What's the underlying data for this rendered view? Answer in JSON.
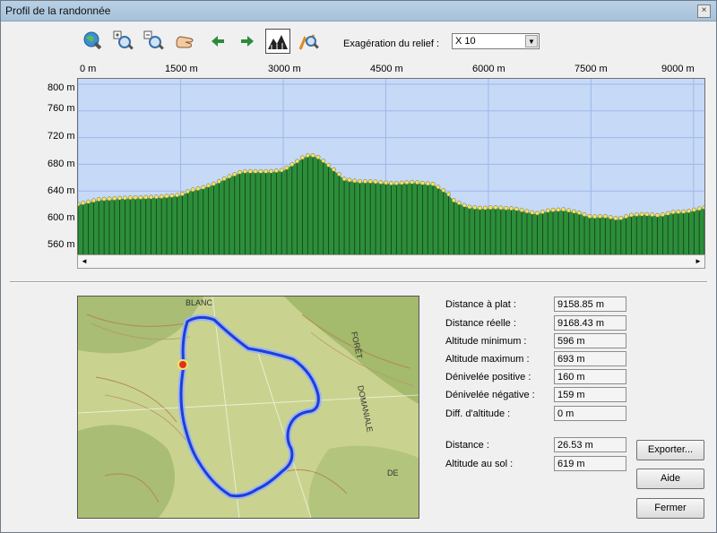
{
  "window": {
    "title": "Profil de la randonnée",
    "close_glyph": "×"
  },
  "toolbar": {
    "icons": [
      "globe-zoom-icon",
      "zoom-in-icon",
      "zoom-out-icon",
      "pan-hand-icon",
      "arrow-left-icon",
      "arrow-right-icon",
      "terrain-profile-icon",
      "route-search-icon"
    ],
    "exaggeration_label": "Exagération du relief :",
    "exaggeration_value": "X 10"
  },
  "chart_data": {
    "type": "area",
    "xlabel": "",
    "ylabel": "",
    "x_ticks": [
      "0 m",
      "1500 m",
      "3000 m",
      "4500 m",
      "6000 m",
      "7500 m",
      "9000 m"
    ],
    "y_ticks": [
      "800 m",
      "760 m",
      "720 m",
      "680 m",
      "640 m",
      "600 m",
      "560 m"
    ],
    "xlim": [
      0,
      9158.85
    ],
    "ylim": [
      545,
      808
    ],
    "grid": true,
    "colors": {
      "fill": "#2d8e3a",
      "points": "#f4e06a",
      "background": "#c6d9f7",
      "grid": "#9db9e8"
    },
    "x": [
      0,
      300,
      600,
      900,
      1200,
      1500,
      1650,
      1800,
      2000,
      2200,
      2400,
      2600,
      2800,
      3000,
      3200,
      3300,
      3400,
      3500,
      3600,
      3750,
      3900,
      4100,
      4300,
      4600,
      4900,
      5200,
      5400,
      5500,
      5700,
      5900,
      6100,
      6400,
      6700,
      6900,
      7100,
      7300,
      7500,
      7700,
      7900,
      8100,
      8300,
      8500,
      8700,
      8900,
      9158
    ],
    "values": [
      619,
      626,
      628,
      629,
      630,
      633,
      640,
      643,
      650,
      660,
      668,
      668,
      668,
      670,
      683,
      690,
      693,
      690,
      683,
      670,
      656,
      653,
      653,
      650,
      652,
      649,
      636,
      624,
      615,
      613,
      614,
      612,
      605,
      610,
      611,
      607,
      600,
      601,
      597,
      603,
      604,
      602,
      607,
      608,
      614
    ]
  },
  "map_panel": {
    "colors": {
      "track": "#1b3fd6",
      "track_halo": "#9fb2f0",
      "start_marker": "#e0301e",
      "terrain": "#c8d28e",
      "forest": "#9eb66a",
      "contour": "#b08a50"
    },
    "text": [
      "BLANC",
      "FORÊT",
      "DOMANIALE",
      "DE"
    ]
  },
  "stats": [
    {
      "label": "Distance à plat :",
      "value": "9158.85 m"
    },
    {
      "label": "Distance réelle :",
      "value": "9168.43 m"
    },
    {
      "label": "Altitude minimum :",
      "value": "596 m"
    },
    {
      "label": "Altitude maximum :",
      "value": "693 m"
    },
    {
      "label": "Dénivelée positive :",
      "value": "160 m"
    },
    {
      "label": "Dénivelée négative :",
      "value": "159 m"
    },
    {
      "label": "Diff. d'altitude :",
      "value": "0 m"
    }
  ],
  "cursor_info": [
    {
      "label": "Distance :",
      "value": "26.53 m"
    },
    {
      "label": "Altitude au sol :",
      "value": "619 m"
    }
  ],
  "buttons": {
    "export": "Exporter...",
    "help": "Aide",
    "close": "Fermer"
  },
  "scrollbar": {
    "left_arrow": "◄",
    "right_arrow": "►"
  }
}
